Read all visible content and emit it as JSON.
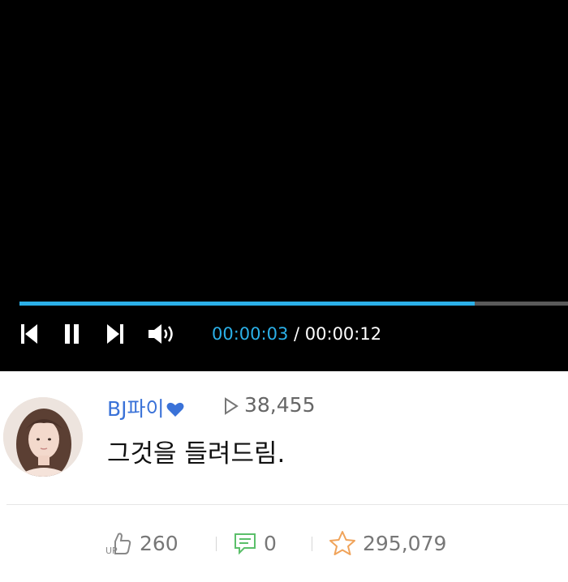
{
  "player": {
    "progress_fraction": 0.83,
    "current_time": "00:00:03",
    "separator": " / ",
    "duration": "00:00:12",
    "accent_color": "#2bb0e8"
  },
  "post": {
    "author": "BJ파이",
    "views": "38,455",
    "title": "그것을 들려드림.",
    "name_color": "#3a72d8"
  },
  "stats": {
    "likes": "260",
    "comments": "0",
    "favorites": "295,079"
  }
}
